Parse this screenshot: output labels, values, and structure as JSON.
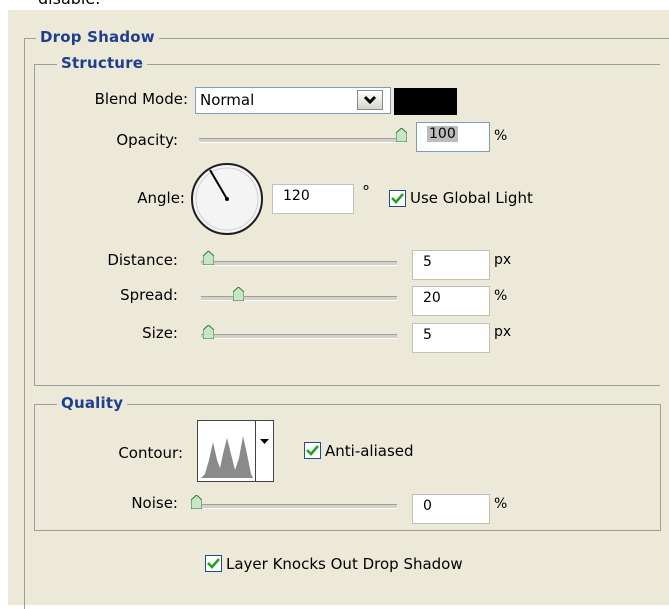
{
  "top_fragment": "disable.",
  "drop_shadow": {
    "legend": "Drop Shadow"
  },
  "structure": {
    "legend": "Structure",
    "blend_mode": {
      "label": "Blend Mode:",
      "value": "Normal",
      "swatch_color": "#000000"
    },
    "opacity": {
      "label": "Opacity:",
      "value": "100",
      "unit": "%",
      "fraction": 1.0
    },
    "angle": {
      "label": "Angle:",
      "value": "120",
      "unit": "°"
    },
    "use_global_light": {
      "label": "Use Global Light",
      "checked": true
    },
    "distance": {
      "label": "Distance:",
      "value": "5",
      "unit": "px",
      "fraction": 0.0
    },
    "spread": {
      "label": "Spread:",
      "value": "20",
      "unit": "%",
      "fraction": 0.2
    },
    "size": {
      "label": "Size:",
      "value": "5",
      "unit": "px",
      "fraction": 0.0
    }
  },
  "quality": {
    "legend": "Quality",
    "contour": {
      "label": "Contour:"
    },
    "anti_aliased": {
      "label": "Anti-aliased",
      "checked": true
    },
    "noise": {
      "label": "Noise:",
      "value": "0",
      "unit": "%",
      "fraction": 0.0
    }
  },
  "layer_knocks_out": {
    "label": "Layer Knocks Out Drop Shadow",
    "checked": true
  },
  "colors": {
    "legend_blue": "#1e3f8f",
    "panel_bg": "#ece9d8",
    "check_green": "#21a121"
  }
}
